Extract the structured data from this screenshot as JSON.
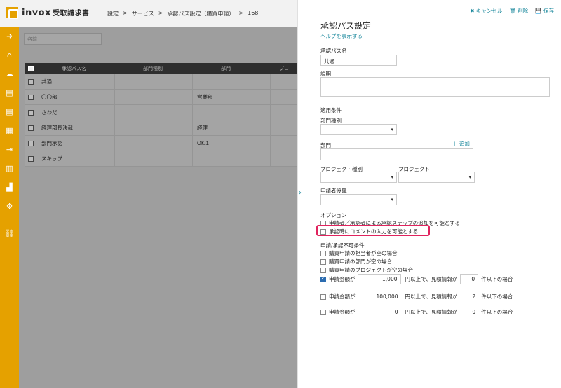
{
  "header": {
    "logo": "invox",
    "logo_sub": "受取請求書",
    "breadcrumb": [
      "設定",
      "サービス",
      "承認パス設定（購買申請）",
      "168"
    ]
  },
  "sidebar": {
    "icons": [
      "arrow-right-icon",
      "home-icon",
      "cloud-upload-icon",
      "document-icon",
      "document-icon",
      "building-icon",
      "export-icon",
      "report-icon",
      "chart-icon",
      "gear-icon",
      "link-icon"
    ]
  },
  "main": {
    "filter_placeholder": "名前",
    "columns": [
      "承認パス名",
      "部門種別",
      "部門",
      "プロ"
    ],
    "rows": [
      {
        "name": "共通",
        "dept_type": "",
        "dept": ""
      },
      {
        "name": "〇〇部",
        "dept_type": "",
        "dept": "営業部"
      },
      {
        "name": "さわだ",
        "dept_type": "",
        "dept": ""
      },
      {
        "name": "経理部長決裁",
        "dept_type": "",
        "dept": "経理"
      },
      {
        "name": "部門承認",
        "dept_type": "",
        "dept": "OK１"
      },
      {
        "name": "スキップ",
        "dept_type": "",
        "dept": ""
      }
    ]
  },
  "panel": {
    "cancel": "✖ キャンセル",
    "delete": "🗑 削除",
    "save": "💾 保存",
    "title": "承認パス設定",
    "help": "ヘルプを表示する",
    "name_label": "承認パス名",
    "name_value": "共通",
    "desc_label": "説明",
    "conditions_label": "適用条件",
    "dept_type_label": "部門種別",
    "dept_label": "部門",
    "add_label": "＋ 追加",
    "project_type_label": "プロジェクト種別",
    "project_label": "プロジェクト",
    "role_label": "申請者役職",
    "options_label": "オプション",
    "option1": "申請者／承認者による承認ステップの追加を可能とする",
    "option2": "承認時にコメントの入力を可能とする",
    "deny_label": "申請/承認不可条件",
    "deny1": "購買申請の担当者が空の場合",
    "deny2": "購買申請の部門が空の場合",
    "deny3": "購買申請のプロジェクトが空の場合",
    "amount_rows": [
      {
        "checked": true,
        "prefix": "申請金額が",
        "amount": "1,000",
        "mid": "円以上で、見積情報が",
        "count": "0",
        "suffix": "件以下の場合"
      },
      {
        "checked": false,
        "prefix": "申請金額が",
        "amount": "100,000",
        "mid": "円以上で、見積情報が",
        "count": "2",
        "suffix": "件以下の場合"
      },
      {
        "checked": false,
        "prefix": "申請金額が",
        "amount": "0",
        "mid": "円以上で、見積情報が",
        "count": "0",
        "suffix": "件以下の場合"
      }
    ]
  },
  "colors": {
    "accent": "#1e8a9e",
    "sidebar": "#e5a100",
    "highlight": "#e0235e"
  }
}
